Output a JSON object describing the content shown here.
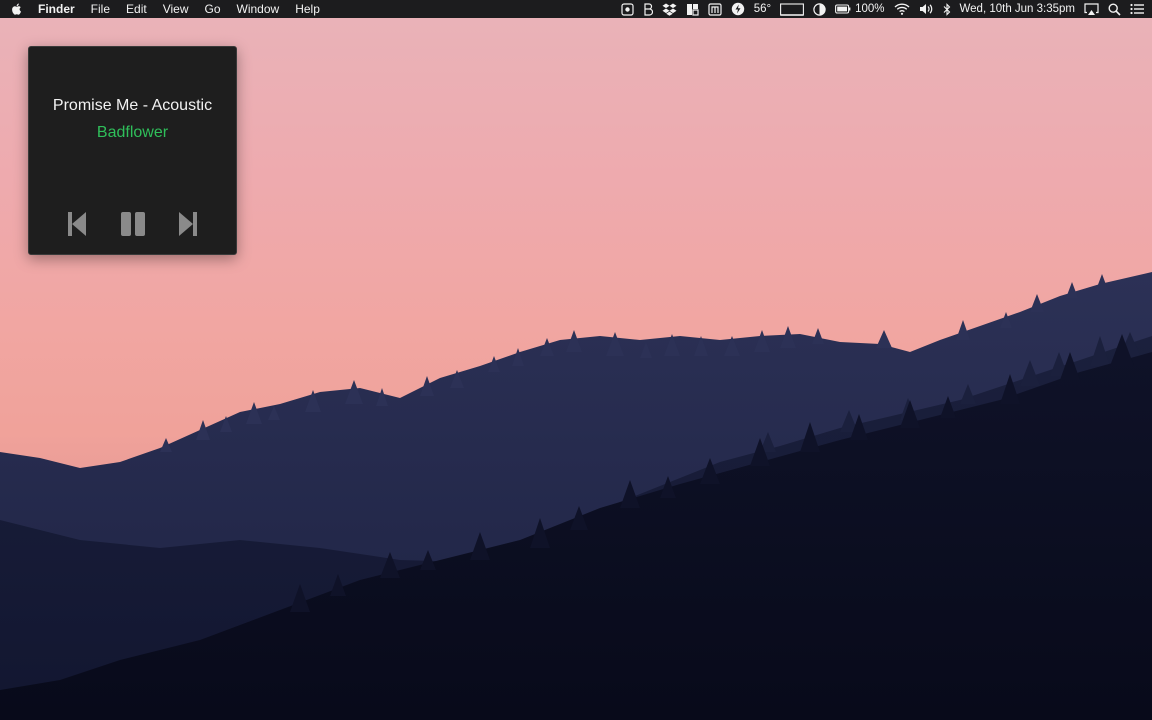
{
  "menubar": {
    "apple_icon": "apple-logo-icon",
    "app_name": "Finder",
    "menus": [
      "File",
      "Edit",
      "View",
      "Go",
      "Window",
      "Help"
    ],
    "status_icons": [
      "screen-record-icon",
      "bartender-icon",
      "dropbox-icon",
      "grid-icon",
      "notes-icon",
      "flux-icon"
    ],
    "temperature": "56°",
    "battery_percent": "100%",
    "datetime": "Wed, 10th Jun 3:35pm",
    "trailing_icons": [
      "airplay-icon",
      "search-icon",
      "notification-center-icon"
    ]
  },
  "player": {
    "title": "Promise Me - Acoustic",
    "artist": "Badflower",
    "artist_color": "#2fbf5a",
    "controls": [
      "previous-icon",
      "pause-icon",
      "next-icon"
    ]
  }
}
